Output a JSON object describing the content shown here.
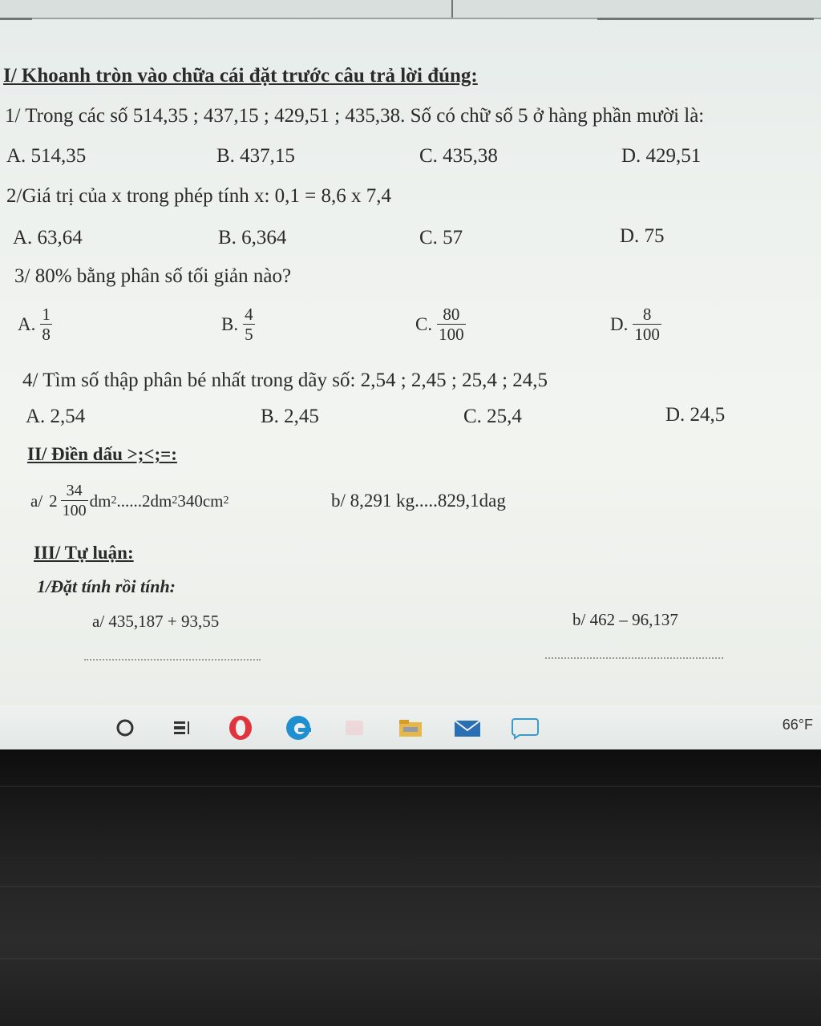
{
  "section1": {
    "heading": "I/ Khoanh tròn vào chữa cái đặt trước câu trả lời đúng:",
    "q1": {
      "text": "1/ Trong các số 514,35 ; 437,15 ; 429,51 ; 435,38. Số có chữ số 5 ở hàng phần mười là:",
      "a": "A. 514,35",
      "b": "B. 437,15",
      "c": "C. 435,38",
      "d": "D. 429,51"
    },
    "q2": {
      "text": "2/Giá trị của x trong phép tính x: 0,1 = 8,6 x 7,4",
      "a": "A. 63,64",
      "b": "B. 6,364",
      "c": "C. 57",
      "d": "D. 75"
    },
    "q3": {
      "text": "3/ 80% bằng phân số tối giản nào?",
      "a": {
        "label": "A.",
        "num": "1",
        "den": "8"
      },
      "b": {
        "label": "B.",
        "num": "4",
        "den": "5"
      },
      "c": {
        "label": "C.",
        "num": "80",
        "den": "100"
      },
      "d": {
        "label": "D.",
        "num": "8",
        "den": "100"
      }
    },
    "q4": {
      "text": "4/ Tìm số thập phân bé nhất trong dãy số: 2,54 ; 2,45 ; 25,4 ; 24,5",
      "a": "A. 2,54",
      "b": "B. 2,45",
      "c": "C. 25,4",
      "d": "D. 24,5"
    }
  },
  "section2": {
    "heading": "II/ Điền dấu >;<;=:",
    "a": {
      "prefix": "a/",
      "whole": "2",
      "num": "34",
      "den": "100",
      "unit": "dm",
      "mid": "......2dm",
      "rest": "340cm"
    },
    "b": "b/ 8,291 kg.....829,1dag"
  },
  "section3": {
    "heading": "III/ Tự luận:",
    "sub": "1/Đặt tính rồi tính:",
    "a": "a/ 435,187 + 93,55",
    "b": "b/ 462 – 96,137"
  },
  "taskbar": {
    "weather": "66°F"
  },
  "colors": {
    "screen_bg": "#eef2ef",
    "bezel": "#1f1f1f",
    "opera_red": "#e0353f",
    "edge_blue": "#1f8fd0",
    "mail_blue": "#2a6fb5"
  }
}
